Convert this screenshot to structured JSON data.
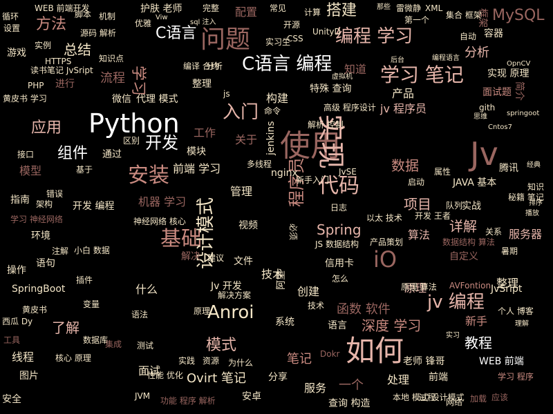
{
  "colors": {
    "background": "#000000",
    "bright": "#ffffff",
    "cream": "#f4e6c7",
    "pink": "#e6b5aa",
    "rose": "#c98a80",
    "mauve": "#9a6660",
    "dim": "#6a4844"
  },
  "words": [
    {
      "text": "Python",
      "color": "bright"
    },
    {
      "text": "使用",
      "color": "mauve"
    },
    {
      "text": "Jv",
      "color": "mauve"
    },
    {
      "text": "如何",
      "color": "pink"
    },
    {
      "text": "实现",
      "color": "pink"
    },
    {
      "text": "问题",
      "color": "mauve"
    },
    {
      "text": "学习 笔记",
      "color": "pink"
    },
    {
      "text": "编程 学习",
      "color": "pink"
    },
    {
      "text": "C语言 编程",
      "color": "bright"
    },
    {
      "text": "C语言",
      "color": "bright"
    },
    {
      "text": "安装",
      "color": "rose"
    },
    {
      "text": "基础",
      "color": "rose"
    },
    {
      "text": "代码",
      "color": "pink"
    },
    {
      "text": "入门",
      "color": "pink"
    },
    {
      "text": "开发",
      "color": "bright"
    },
    {
      "text": "Anroi",
      "color": "cream"
    },
    {
      "text": "设计模式",
      "color": "cream"
    },
    {
      "text": "iO",
      "color": "mauve"
    },
    {
      "text": "jv 编程",
      "color": "pink"
    },
    {
      "text": "MySQL",
      "color": "mauve"
    },
    {
      "text": "搭建",
      "color": "cream"
    },
    {
      "text": "方法",
      "color": "rose"
    },
    {
      "text": "应用",
      "color": "pink"
    },
    {
      "text": "组件",
      "color": "bright"
    },
    {
      "text": "学习",
      "color": "rose"
    },
    {
      "text": "总结",
      "color": "cream"
    },
    {
      "text": "模式",
      "color": "pink"
    },
    {
      "text": "教程",
      "color": "bright"
    },
    {
      "text": "了解",
      "color": "pink"
    },
    {
      "text": "项目",
      "color": "pink"
    },
    {
      "text": "详解",
      "color": "pink"
    },
    {
      "text": "数据",
      "color": "rose"
    },
    {
      "text": "程序员",
      "color": "rose"
    },
    {
      "text": "Spring",
      "color": "pink"
    },
    {
      "text": "深度 学习",
      "color": "rose"
    },
    {
      "text": "函数 软件",
      "color": "mauve"
    },
    {
      "text": "Ovirt 笔记",
      "color": "cream"
    },
    {
      "text": "分析",
      "color": "pink"
    },
    {
      "text": "流程",
      "color": "mauve"
    },
    {
      "text": "前端 学习",
      "color": "cream"
    },
    {
      "text": "机器 学习",
      "color": "mauve"
    },
    {
      "text": "服务器",
      "color": "pink"
    },
    {
      "text": "jv 程序员",
      "color": "pink"
    },
    {
      "text": "实现 原理",
      "color": "cream"
    },
    {
      "text": "配置",
      "color": "mauve"
    },
    {
      "text": "构建",
      "color": "cream"
    },
    {
      "text": "产品",
      "color": "cream"
    },
    {
      "text": "面试题",
      "color": "rose"
    },
    {
      "text": "工作",
      "color": "mauve"
    },
    {
      "text": "管理",
      "color": "cream"
    },
    {
      "text": "技术",
      "color": "cream"
    },
    {
      "text": "原理",
      "color": "pink"
    },
    {
      "text": "模型",
      "color": "mauve"
    },
    {
      "text": "指南",
      "color": "cream"
    },
    {
      "text": "线程",
      "color": "cream"
    },
    {
      "text": "面试",
      "color": "cream"
    },
    {
      "text": "图片",
      "color": "cream"
    },
    {
      "text": "服务",
      "color": "cream"
    },
    {
      "text": "老师 锋哥",
      "color": "cream"
    },
    {
      "text": "WEB 前端",
      "color": "bright"
    },
    {
      "text": "一个",
      "color": "mauve"
    },
    {
      "text": "处理",
      "color": "cream"
    },
    {
      "text": "分享",
      "color": "cream"
    },
    {
      "text": "笔记",
      "color": "rose"
    },
    {
      "text": "整理",
      "color": "cream"
    },
    {
      "text": "新手",
      "color": "rose"
    },
    {
      "text": "什么",
      "color": "cream"
    },
    {
      "text": "JvSript",
      "color": "cream"
    },
    {
      "text": "创建",
      "color": "cream"
    },
    {
      "text": "算法",
      "color": "pink"
    },
    {
      "text": "腾讯",
      "color": "cream"
    },
    {
      "text": "JAVA 基本",
      "color": "cream"
    },
    {
      "text": "系统",
      "color": "cream"
    },
    {
      "text": "操作",
      "color": "cream"
    },
    {
      "text": "实战",
      "color": "cream"
    },
    {
      "text": "游戏",
      "color": "cream"
    },
    {
      "text": "知道",
      "color": "mauve"
    },
    {
      "text": "特殊 查询",
      "color": "cream"
    },
    {
      "text": "简介",
      "color": "mauve"
    },
    {
      "text": "框架",
      "color": "mauve"
    },
    {
      "text": "容器",
      "color": "cream"
    },
    {
      "text": "视频",
      "color": "cream"
    },
    {
      "text": "模块",
      "color": "cream"
    },
    {
      "text": "jenkins",
      "color": "cream"
    },
    {
      "text": "实例",
      "color": "cream"
    },
    {
      "text": "护肤 老师",
      "color": "cream"
    },
    {
      "text": "完整",
      "color": "cream"
    },
    {
      "text": "开源",
      "color": "cream"
    },
    {
      "text": "第一个",
      "color": "cream"
    },
    {
      "text": "雷微静",
      "color": "cream"
    },
    {
      "text": "集合 框架",
      "color": "cream"
    },
    {
      "text": "自动",
      "color": "cream"
    },
    {
      "text": "读书笔记 JvSript",
      "color": "cream"
    },
    {
      "text": "进行",
      "color": "mauve"
    },
    {
      "text": "黄皮书 学习",
      "color": "cream"
    },
    {
      "text": "微信",
      "color": "cream"
    },
    {
      "text": "代理 模式",
      "color": "cream"
    },
    {
      "text": "高级 程序设计",
      "color": "cream"
    },
    {
      "text": "解析 控制",
      "color": "cream"
    },
    {
      "text": "通过",
      "color": "cream"
    },
    {
      "text": "关于",
      "color": "mauve"
    },
    {
      "text": "多线程",
      "color": "cream"
    },
    {
      "text": "nginx",
      "color": "cream"
    },
    {
      "text": "JvSE",
      "color": "cream"
    },
    {
      "text": "启动",
      "color": "cream"
    },
    {
      "text": "属性",
      "color": "cream"
    },
    {
      "text": "知识",
      "color": "cream"
    },
    {
      "text": "秘籍 笔记",
      "color": "cream"
    },
    {
      "text": "排序",
      "color": "cream"
    },
    {
      "text": "播放",
      "color": "cream"
    },
    {
      "text": "日志",
      "color": "cream"
    },
    {
      "text": "以太 技术",
      "color": "cream"
    },
    {
      "text": "开发 王者",
      "color": "cream"
    },
    {
      "text": "数据结构 算法",
      "color": "mauve"
    },
    {
      "text": "神经网络 核心",
      "color": "cream"
    },
    {
      "text": "开发 编程",
      "color": "cream"
    },
    {
      "text": "学习 神经网络",
      "color": "mauve"
    },
    {
      "text": "环境",
      "color": "cream"
    },
    {
      "text": "语句",
      "color": "cream"
    },
    {
      "text": "信用卡",
      "color": "cream"
    },
    {
      "text": "JS 数据结构",
      "color": "cream"
    },
    {
      "text": "产品策划",
      "color": "cream"
    },
    {
      "text": "自定义",
      "color": "mauve"
    },
    {
      "text": "暑期",
      "color": "cream"
    },
    {
      "text": "解决",
      "color": "mauve"
    },
    {
      "text": "建议",
      "color": "cream"
    },
    {
      "text": "文件",
      "color": "cream"
    },
    {
      "text": "Jv 开发",
      "color": "cream"
    },
    {
      "text": "解决方案",
      "color": "cream"
    },
    {
      "text": "阿里",
      "color": "cream"
    },
    {
      "text": "SpringBoot",
      "color": "cream"
    },
    {
      "text": "黄皮书",
      "color": "cream"
    },
    {
      "text": "技术",
      "color": "cream"
    },
    {
      "text": "原理 算法",
      "color": "cream"
    },
    {
      "text": "AVFontion",
      "color": "rose"
    },
    {
      "text": "个人 博客",
      "color": "cream"
    },
    {
      "text": "西瓜 Dy",
      "color": "cream"
    },
    {
      "text": "集成",
      "color": "mauve"
    },
    {
      "text": "测试",
      "color": "cream"
    },
    {
      "text": "工具",
      "color": "mauve"
    },
    {
      "text": "核心 原理",
      "color": "cream"
    },
    {
      "text": "数据库",
      "color": "cream"
    },
    {
      "text": "实践",
      "color": "cream"
    },
    {
      "text": "资源",
      "color": "cream"
    },
    {
      "text": "语言",
      "color": "cream"
    },
    {
      "text": "Dokr",
      "color": "mauve"
    },
    {
      "text": "前端",
      "color": "cream"
    },
    {
      "text": "学习 程序",
      "color": "rose"
    },
    {
      "text": "性能 优化",
      "color": "cream"
    },
    {
      "text": "安卓",
      "color": "cream"
    },
    {
      "text": "查询 构造",
      "color": "cream"
    },
    {
      "text": "安全",
      "color": "cream"
    },
    {
      "text": "功能 程序 解析",
      "color": "mauve"
    },
    {
      "text": "本地 模式 设计模式",
      "color": "cream"
    },
    {
      "text": "过程",
      "color": "cream"
    },
    {
      "text": "网络",
      "color": "cream"
    },
    {
      "text": "加载",
      "color": "mauve"
    },
    {
      "text": "应该",
      "color": "mauve"
    },
    {
      "text": "WEB 前端开发",
      "color": "cream"
    },
    {
      "text": "循环",
      "color": "cream"
    },
    {
      "text": "设置",
      "color": "cream"
    },
    {
      "text": "脚本",
      "color": "cream"
    },
    {
      "text": "机制",
      "color": "cream"
    },
    {
      "text": "常见",
      "color": "cream"
    },
    {
      "text": "计算",
      "color": "cream"
    },
    {
      "text": "那些",
      "color": "cream"
    },
    {
      "text": "XML",
      "color": "cream"
    },
    {
      "text": "源码 解析",
      "color": "cream"
    },
    {
      "text": "优雅",
      "color": "cream"
    },
    {
      "text": "Viw",
      "color": "cream"
    },
    {
      "text": "实习生",
      "color": "cream"
    },
    {
      "text": "CSS",
      "color": "cream"
    },
    {
      "text": "UnityD",
      "color": "cream"
    },
    {
      "text": "后台",
      "color": "cream"
    },
    {
      "text": "编程语言",
      "color": "cream"
    },
    {
      "text": "OpnCV",
      "color": "cream"
    },
    {
      "text": "HTTPS",
      "color": "cream"
    },
    {
      "text": "知识点",
      "color": "cream"
    },
    {
      "text": "编译 合约",
      "color": "cream"
    },
    {
      "text": "分析",
      "color": "cream"
    },
    {
      "text": "整理",
      "color": "cream"
    },
    {
      "text": "js",
      "color": "cream"
    },
    {
      "text": "命令",
      "color": "cream"
    },
    {
      "text": "PHP",
      "color": "cream"
    },
    {
      "text": "接口",
      "color": "cream"
    },
    {
      "text": "错误",
      "color": "cream"
    },
    {
      "text": "基于",
      "color": "cream"
    },
    {
      "text": "区别",
      "color": "cream"
    },
    {
      "text": "gith",
      "color": "cream"
    },
    {
      "text": "新手入门",
      "color": "cream"
    },
    {
      "text": "思维",
      "color": "cream"
    },
    {
      "text": "springoot",
      "color": "cream"
    },
    {
      "text": "原理",
      "color": "cream"
    },
    {
      "text": "语法",
      "color": "cream"
    },
    {
      "text": "怎么",
      "color": "cream"
    },
    {
      "text": "虚拟机",
      "color": "cream"
    },
    {
      "text": "为什么",
      "color": "cream"
    },
    {
      "text": "小白 数据",
      "color": "cream"
    },
    {
      "text": "注解",
      "color": "cream"
    },
    {
      "text": "变量",
      "color": "cream"
    },
    {
      "text": "插件",
      "color": "cream"
    },
    {
      "text": "架构",
      "color": "cream"
    },
    {
      "text": "必须",
      "color": "cream"
    },
    {
      "text": "Cntos7",
      "color": "cream"
    },
    {
      "text": "sql 注入",
      "color": "cream"
    },
    {
      "text": "JVM",
      "color": "cream"
    },
    {
      "text": "实习",
      "color": "cream"
    },
    {
      "text": "理解",
      "color": "cream"
    },
    {
      "text": "关系",
      "color": "cream"
    },
    {
      "text": "经典",
      "color": "cream"
    },
    {
      "text": "队列",
      "color": "cream"
    },
    {
      "text": "分类",
      "color": "cream"
    },
    {
      "text": "动态",
      "color": "cream"
    },
    {
      "text": "条件",
      "color": "cream"
    }
  ]
}
